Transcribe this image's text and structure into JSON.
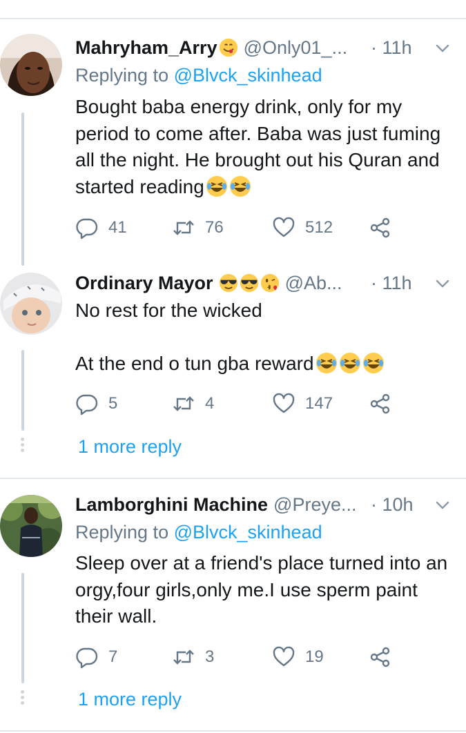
{
  "tweets": [
    {
      "name": "Mahryham_Arry",
      "name_emojis": [
        "yum-emoji"
      ],
      "handle": "@Only01_...",
      "time": "· 11h",
      "replying_prefix": "Replying to ",
      "replying_to": "@Blvck_skinhead",
      "text": "Bought baba energy drink, only for my period to come after. Baba was just fuming all the night.  He brought out his Quran and started reading",
      "text_emojis": [
        "laughing-tears-emoji",
        "laughing-tears-emoji"
      ],
      "replies": "41",
      "retweets": "76",
      "likes": "512"
    },
    {
      "name": "Ordinary Mayor",
      "name_emojis": [
        "sunglasses-emoji",
        "sunglasses-emoji",
        "kiss-emoji"
      ],
      "handle": "@Ab...",
      "time": "· 11h",
      "text_line1": "No rest for the wicked",
      "text_line2": "At the end o tun gba reward",
      "text_emojis": [
        "laughing-tears-emoji",
        "laughing-tears-emoji",
        "laughing-tears-emoji"
      ],
      "replies": "5",
      "retweets": "4",
      "likes": "147",
      "more_replies": "1 more reply"
    },
    {
      "name": "Lamborghini Machine",
      "handle": "@Preye...",
      "time": "· 10h",
      "replying_prefix": "Replying to ",
      "replying_to": "@Blvck_skinhead",
      "text": "Sleep over at  a friend's place turned into an orgy,four girls,only me.I use sperm paint their wall.",
      "replies": "7",
      "retweets": "3",
      "likes": "19",
      "more_replies": "1 more reply"
    }
  ],
  "colors": {
    "link": "#1da1f2",
    "secondary_text": "#657786",
    "primary_text": "#14171a",
    "divider": "#e1e8ed",
    "thread_line": "#ccd6dd"
  }
}
